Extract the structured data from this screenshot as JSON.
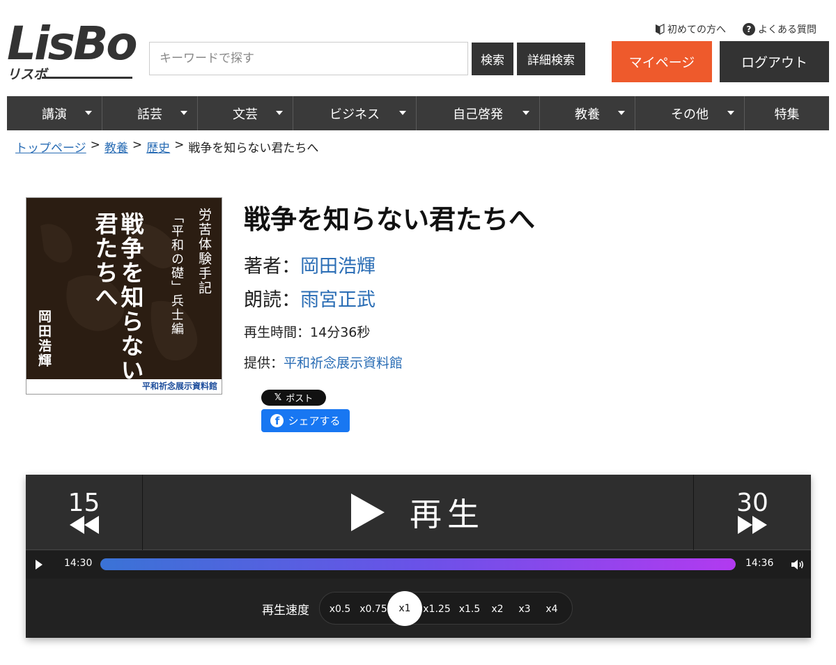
{
  "header": {
    "logo": "LisBo",
    "logo_sub": "リスボ",
    "search_placeholder": "キーワードで探す",
    "search_button": "検索",
    "detail_search_button": "詳細検索",
    "first_time_link": "初めての方へ",
    "faq_link": "よくある質問",
    "mypage_button": "マイページ",
    "logout_button": "ログアウト"
  },
  "nav": {
    "items": [
      {
        "label": "講演",
        "dropdown": true
      },
      {
        "label": "話芸",
        "dropdown": true
      },
      {
        "label": "文芸",
        "dropdown": true
      },
      {
        "label": "ビジネス",
        "dropdown": true
      },
      {
        "label": "自己啓発",
        "dropdown": true
      },
      {
        "label": "教養",
        "dropdown": true
      },
      {
        "label": "その他",
        "dropdown": true
      },
      {
        "label": "特集",
        "dropdown": false
      }
    ]
  },
  "breadcrumb": {
    "items": [
      "トップページ",
      "教養",
      "歴史"
    ],
    "separator": ">",
    "current": "戦争を知らない君たちへ"
  },
  "cover": {
    "series": "労苦体験手記",
    "subtitle": "「平和の礎」兵士編",
    "title_line1": "戦争を知らない",
    "title_line2": "君たちへ",
    "author": "岡田浩輝",
    "publisher": "平和祈念展示資料館"
  },
  "detail": {
    "title": "戦争を知らない君たちへ",
    "author_label": "著者：",
    "author": "岡田浩輝",
    "reader_label": "朗読：",
    "reader": "雨宮正武",
    "duration_label": "再生時間：",
    "duration": "14分36秒",
    "provider_label": "提供：",
    "provider": "平和祈念展示資料館"
  },
  "social": {
    "x_button": "ポスト",
    "fb_button": "シェアする"
  },
  "player": {
    "back_seconds": "15",
    "forward_seconds": "30",
    "play_label": "再生",
    "current_time": "14:30",
    "duration": "14:36",
    "progress": 1.0,
    "speed_label": "再生速度",
    "speeds": [
      "x0.5",
      "x0.75",
      "x1",
      "x1.25",
      "x1.5",
      "x2",
      "x3",
      "x4"
    ],
    "selected_speed": "x1"
  },
  "colors": {
    "accent": "#ee5a2c",
    "link": "#2a6db5",
    "nav_bg": "#3a3a3a",
    "progress_start": "#3a73d6",
    "progress_end": "#b23af0"
  }
}
